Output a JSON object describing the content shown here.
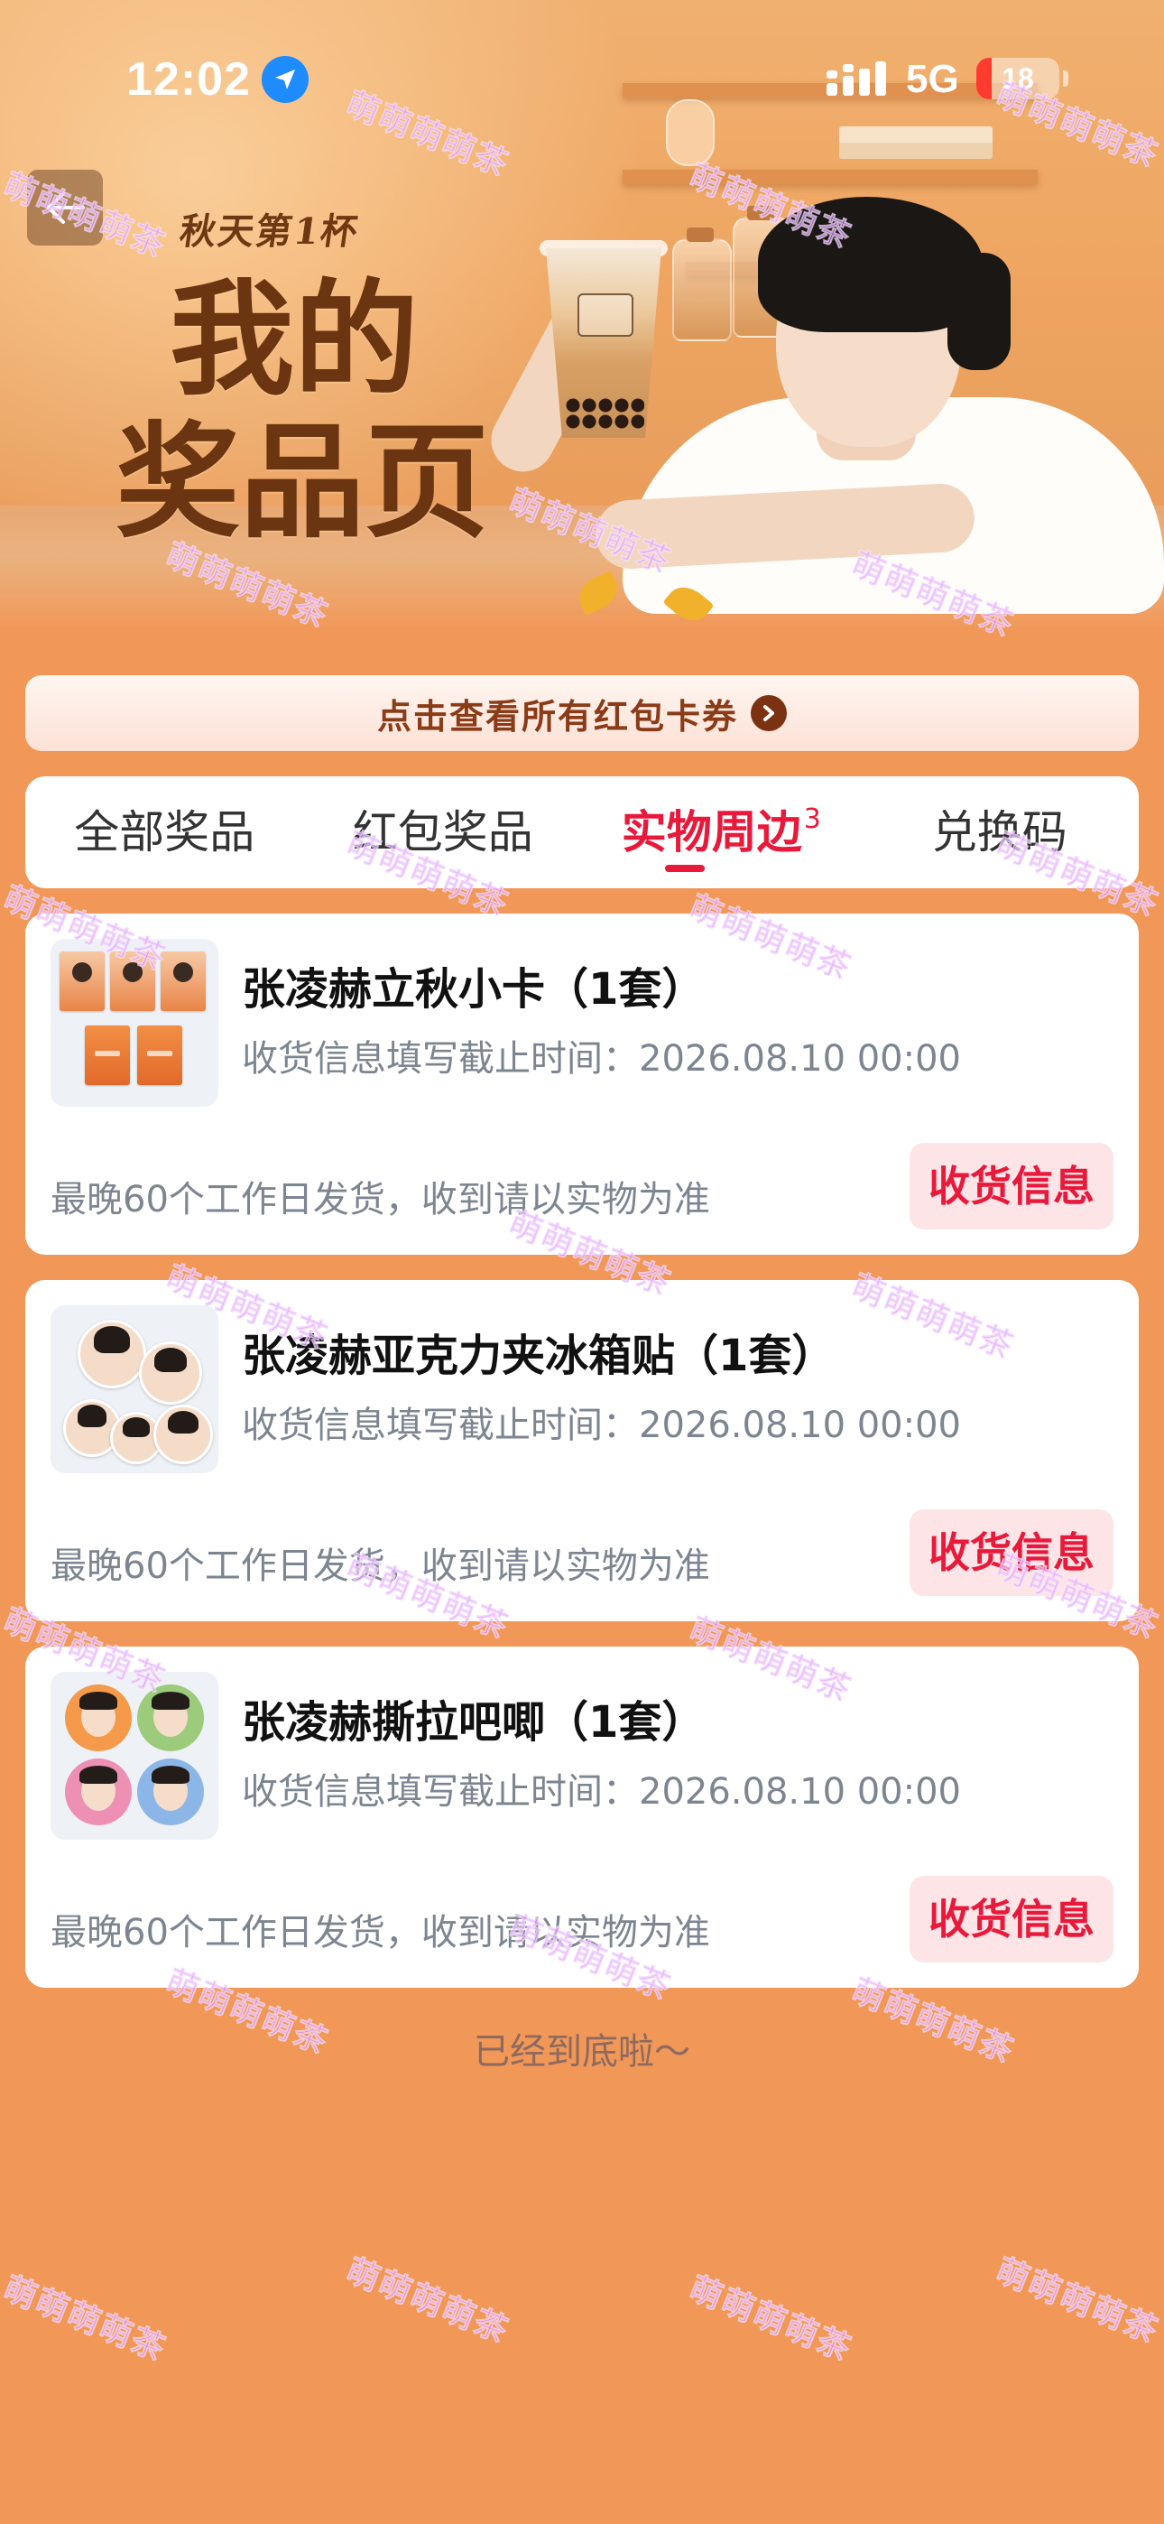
{
  "status_bar": {
    "time": "12:02",
    "network": "5G",
    "battery": "18",
    "battery_level": 0.18,
    "icons": [
      "location-arrow-icon",
      "signal-icon",
      "battery-icon"
    ]
  },
  "banner": {
    "subtitle": "秋天第1杯",
    "title_line1": "我的",
    "title_line2": "奖品页"
  },
  "coupon_bar": {
    "label": "点击查看所有红包卡券"
  },
  "tabs": [
    {
      "label": "全部奖品",
      "badge": ""
    },
    {
      "label": "红包奖品",
      "badge": ""
    },
    {
      "label": "实物周边",
      "badge": "3",
      "active": true
    },
    {
      "label": "兑换码",
      "badge": ""
    }
  ],
  "prizes": [
    {
      "name": "张凌赫立秋小卡（1套）",
      "deadline": "收货信息填写截止时间：2026.08.10 00:00",
      "ship_note": "最晚60个工作日发货，收到请以实物为准",
      "button": "收货信息"
    },
    {
      "name": "张凌赫亚克力夹冰箱贴（1套）",
      "deadline": "收货信息填写截止时间：2026.08.10 00:00",
      "ship_note": "最晚60个工作日发货，收到请以实物为准",
      "button": "收货信息"
    },
    {
      "name": "张凌赫撕拉吧唧（1套）",
      "deadline": "收货信息填写截止时间：2026.08.10 00:00",
      "ship_note": "最晚60个工作日发货，收到请以实物为准",
      "button": "收货信息"
    }
  ],
  "footer": {
    "end_text": "已经到底啦～"
  },
  "watermark": "萌萌萌萌茶",
  "colors": {
    "page_bg": "#F19757",
    "accent_red": "#E8193B",
    "coupon_text": "#8A3B17",
    "muted_text": "#7D8591"
  }
}
